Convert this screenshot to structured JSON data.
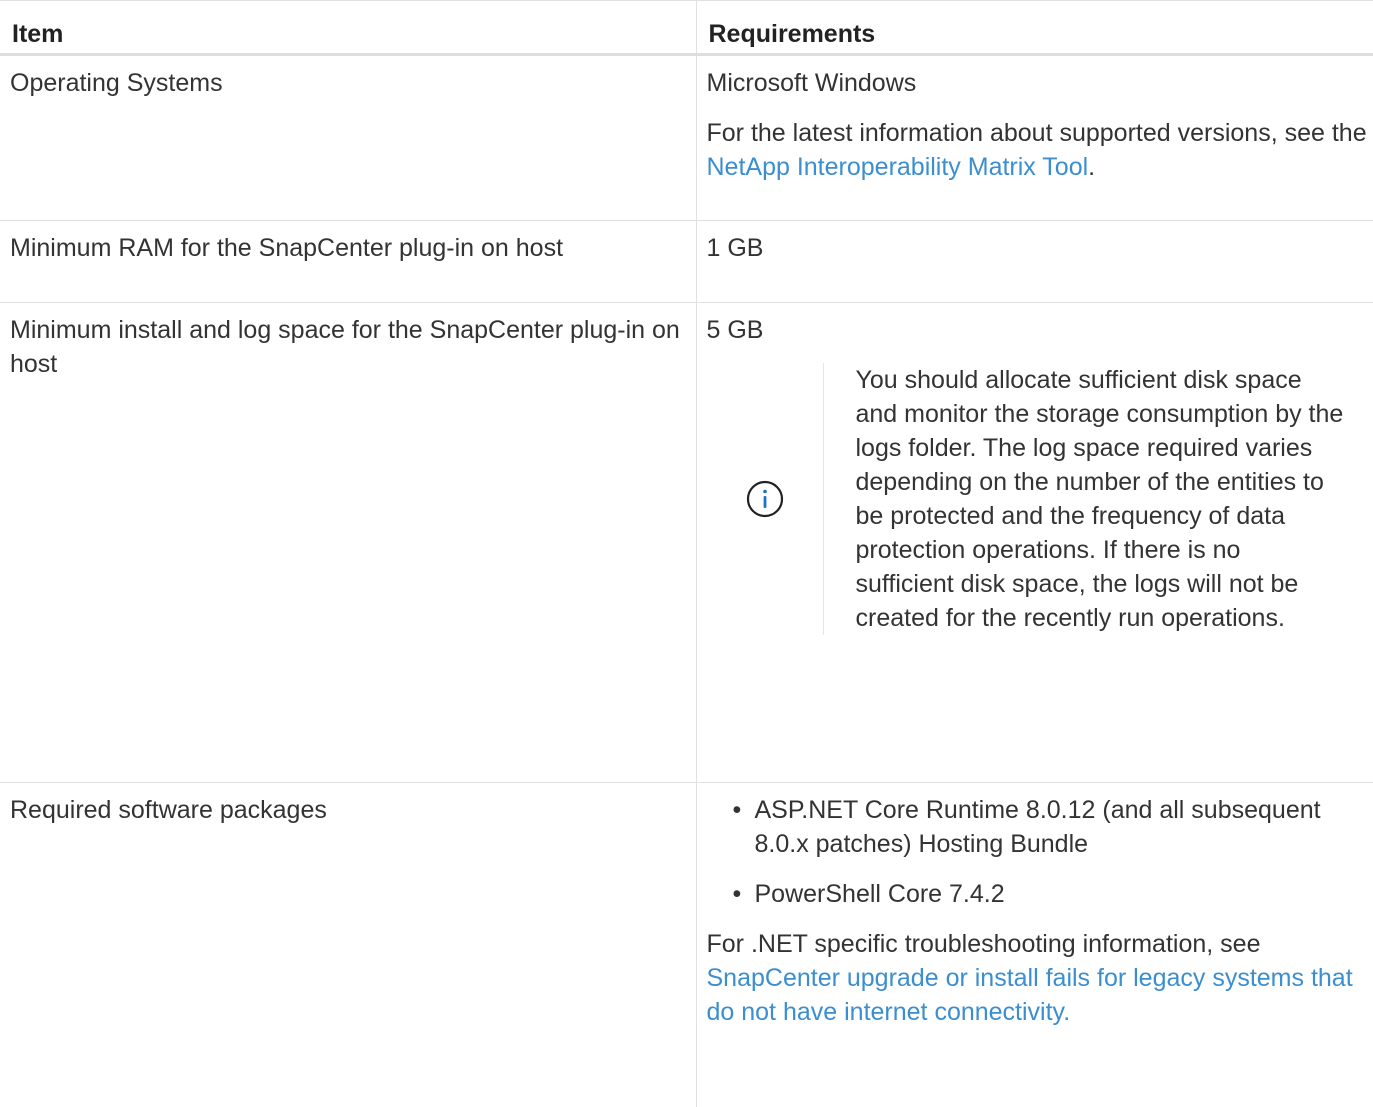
{
  "table": {
    "headers": [
      "Item",
      "Requirements"
    ],
    "rows": {
      "os": {
        "item": "Operating Systems",
        "req_main": "Microsoft Windows",
        "req_note_prefix": "For the latest information about supported versions, see the ",
        "req_link": "NetApp Interoperability Matrix Tool",
        "req_note_suffix": "."
      },
      "ram": {
        "item": "Minimum RAM for the SnapCenter plug-in on host",
        "req_main": "1 GB"
      },
      "space": {
        "item": "Minimum install and log space for the SnapCenter plug-in on host",
        "req_main": "5 GB",
        "note_text": "You should allocate sufficient disk space and monitor the storage consumption by the logs folder. The log space required varies depending on the number of the entities to be protected and the frequency of data protection operations. If there is no sufficient disk space, the logs will not be created for the recently run operations."
      },
      "software": {
        "item": "Required software packages",
        "packages": [
          "ASP.NET Core Runtime 8.0.12 (and all subsequent 8.0.x patches) Hosting Bundle",
          "PowerShell Core 7.4.2"
        ],
        "note_prefix": "For .NET specific troubleshooting information, see ",
        "note_link": "SnapCenter upgrade or install fails for legacy systems that do not have internet connectivity."
      }
    }
  },
  "colors": {
    "text": "#333333",
    "link": "#3b8ed0",
    "border": "#e0e0e0",
    "info_icon": "#1a73c8"
  },
  "icons": {
    "note": "info-circle-icon"
  }
}
